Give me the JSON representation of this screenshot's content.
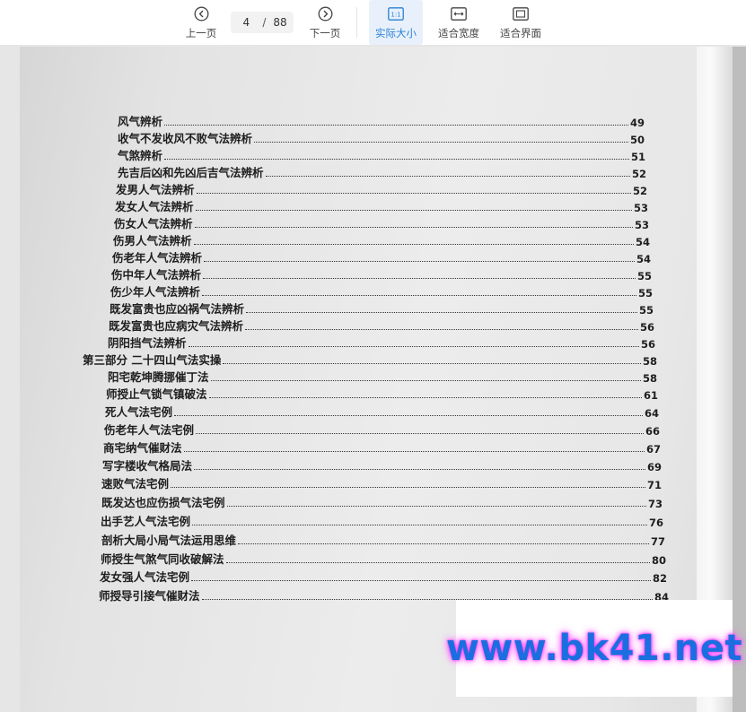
{
  "toolbar": {
    "prev_label": "上一页",
    "next_label": "下一页",
    "current_page": "4",
    "page_separator": "/",
    "total_pages": "88",
    "actual_size_label": "实际大小",
    "actual_size_icon_text": "1:1",
    "fit_width_label": "适合宽度",
    "fit_page_label": "适合界面",
    "active_mode": "actual_size",
    "accent_color": "#2a7fd4"
  },
  "toc": [
    {
      "title": "风气辨析",
      "page": "49"
    },
    {
      "title": "收气不发收风不败气法辨析",
      "page": "50"
    },
    {
      "title": "气煞辨析",
      "page": "51"
    },
    {
      "title": "先吉后凶和先凶后吉气法辨析",
      "page": "52"
    },
    {
      "title": "发男人气法辨析",
      "page": "52"
    },
    {
      "title": "发女人气法辨析",
      "page": "53"
    },
    {
      "title": "伤女人气法辨析",
      "page": "53"
    },
    {
      "title": "伤男人气法辨析",
      "page": "54"
    },
    {
      "title": "伤老年人气法辨析",
      "page": "54"
    },
    {
      "title": "伤中年人气法辨析",
      "page": "55"
    },
    {
      "title": "伤少年人气法辨析",
      "page": "55"
    },
    {
      "title": "既发富贵也应凶祸气法辨析",
      "page": "55"
    },
    {
      "title": "既发富贵也应病灾气法辨析",
      "page": "56"
    },
    {
      "title": "阴阳挡气法辨析",
      "page": "56"
    },
    {
      "title": "第三部分  二十四山气法实操",
      "page": "58"
    },
    {
      "title": "阳宅乾坤腾挪催丁法",
      "page": "58"
    },
    {
      "title": "师授止气锁气镇破法",
      "page": "61"
    },
    {
      "title": "死人气法宅例",
      "page": "64"
    },
    {
      "title": "伤老年人气法宅例",
      "page": "66"
    },
    {
      "title": "商宅纳气催财法",
      "page": "67"
    },
    {
      "title": "写字楼收气格局法",
      "page": "69"
    },
    {
      "title": "速败气法宅例",
      "page": "71"
    },
    {
      "title": "既发达也应伤损气法宅例",
      "page": "73"
    },
    {
      "title": "出手艺人气法宅例",
      "page": "76"
    },
    {
      "title": "剖析大局小局气法运用思维",
      "page": "77"
    },
    {
      "title": "师授生气煞气同收破解法",
      "page": "80"
    },
    {
      "title": "发女强人气法宅例",
      "page": "82"
    },
    {
      "title": "师授导引接气催财法",
      "page": "84"
    }
  ],
  "watermark": {
    "text": "www.bk41.net",
    "color": "#1a6fe0",
    "glow": "#ff55ff"
  }
}
